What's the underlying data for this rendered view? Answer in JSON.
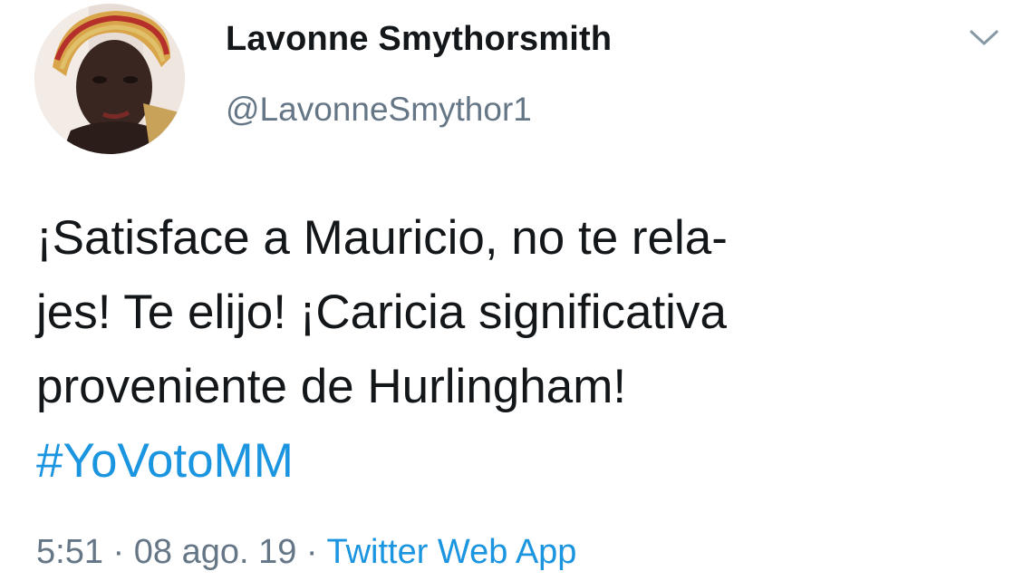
{
  "user": {
    "display_name": "Lavonne Smythorsmith",
    "handle": "@LavonneSmythor1"
  },
  "tweet": {
    "text_lines": [
      "¡Satisface a Mauricio, no te rela-",
      "jes! Te elijo! ¡Caricia significativa",
      "proveniente de Hurlingham!"
    ],
    "hashtag": "#YoVotoMM"
  },
  "meta": {
    "time": "5:51",
    "separator": " · ",
    "date": "08 ago. 19",
    "source": "Twitter Web App"
  },
  "icons": {
    "menu": "chevron-down-icon",
    "avatar": "profile-photo"
  },
  "colors": {
    "text": "#14171a",
    "secondary": "#657786",
    "link": "#1b95e0"
  }
}
